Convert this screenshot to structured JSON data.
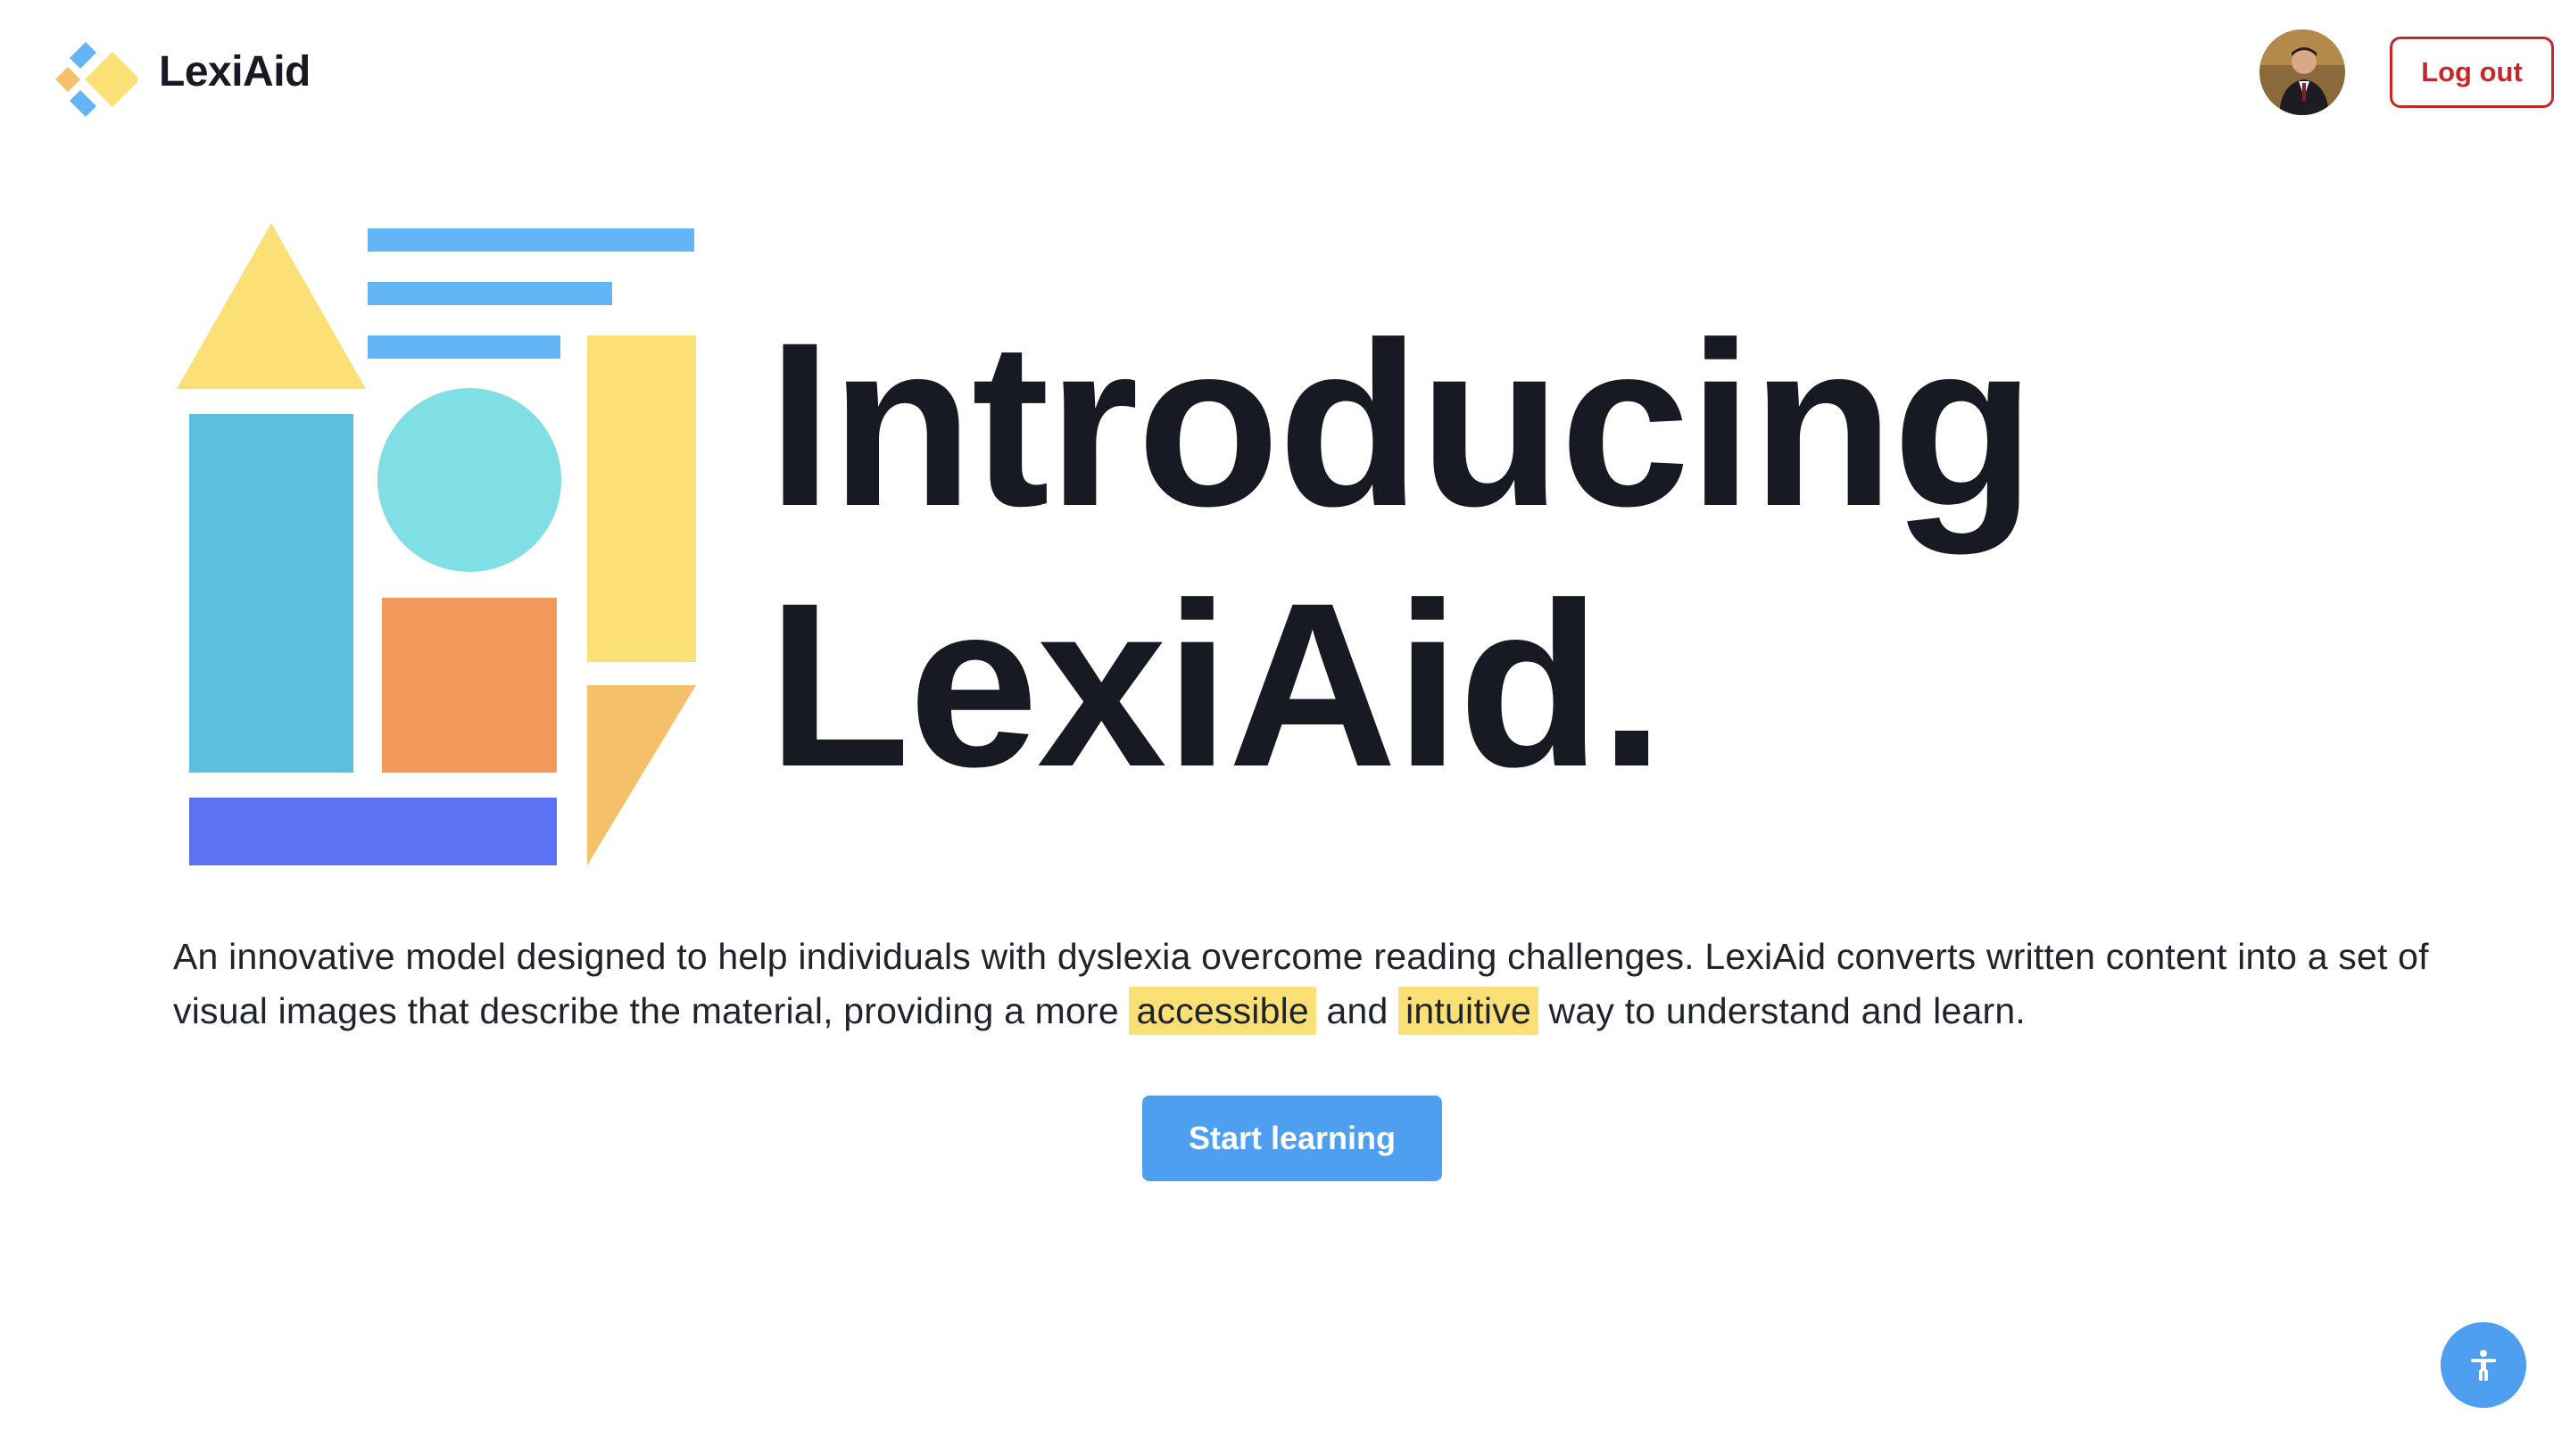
{
  "header": {
    "brand": "LexiAid",
    "logout_label": "Log out"
  },
  "hero": {
    "title_line1": "Introducing",
    "title_line2": "LexiAid."
  },
  "description": {
    "part1": "An innovative model designed to help individuals with dyslexia overcome reading challenges. LexiAid converts written content into a set of visual images that describe the material, providing a more ",
    "highlight1": "accessible",
    "part2": " and ",
    "highlight2": "intuitive",
    "part3": " way to understand and learn."
  },
  "cta": {
    "start_label": "Start learning"
  },
  "icons": {
    "logo": "lexiaid-logo-icon",
    "avatar": "user-avatar",
    "accessibility": "accessibility-person-icon"
  },
  "colors": {
    "text": "#171a22",
    "primary": "#4f9ff0",
    "danger": "#c62828",
    "highlight": "#fae075",
    "shape_yellow": "#fae075",
    "shape_blue_light": "#5bbfde",
    "shape_cyan": "#80dfe5",
    "shape_orange": "#f0995a",
    "shape_indigo": "#5b73f2",
    "shape_lines": "#64b5f6",
    "shape_peach": "#f5c06a"
  }
}
